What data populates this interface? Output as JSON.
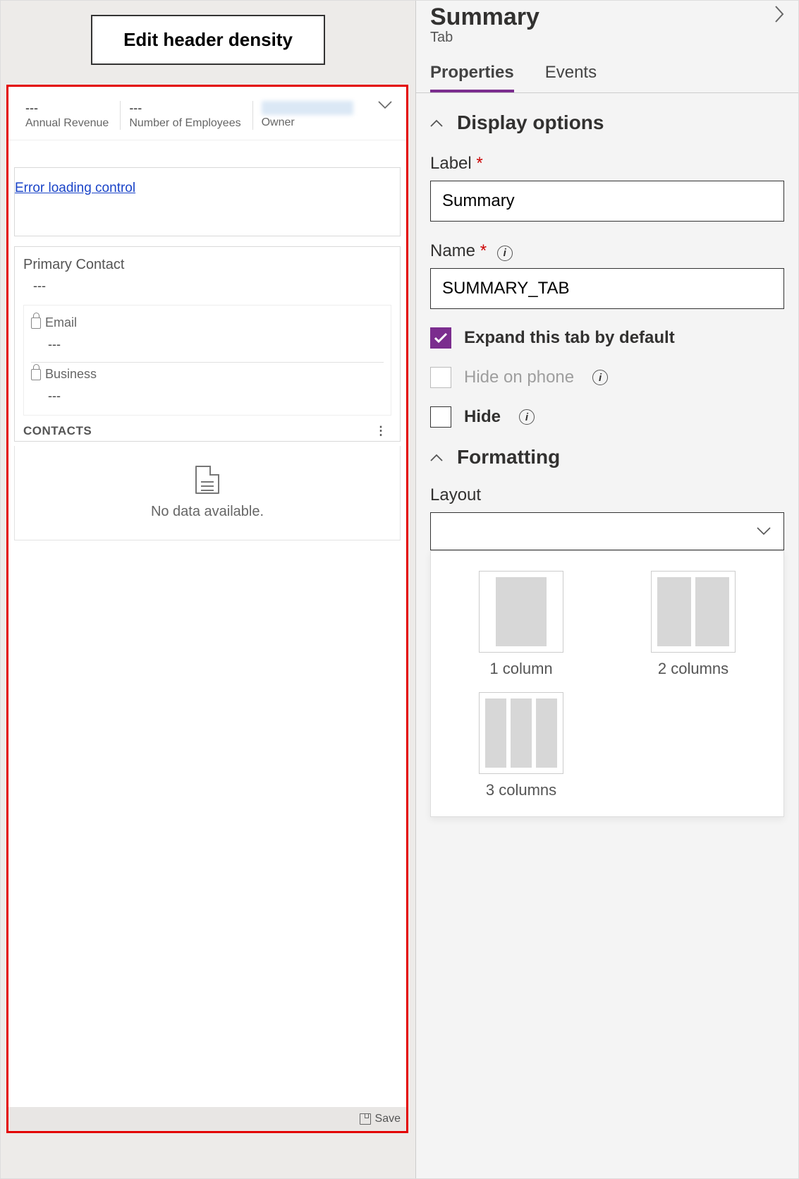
{
  "left": {
    "edit_header_btn": "Edit header density",
    "header_fields": {
      "annual_revenue": {
        "value": "---",
        "label": "Annual Revenue"
      },
      "employees": {
        "value": "---",
        "label": "Number of Employees"
      },
      "owner": {
        "label": "Owner"
      }
    },
    "error_link": "Error loading control",
    "primary_contact": {
      "label": "Primary Contact",
      "value": "---"
    },
    "email": {
      "label": "Email",
      "value": "---"
    },
    "business": {
      "label": "Business",
      "value": "---"
    },
    "contacts_hdr": "CONTACTS",
    "no_data": "No data available.",
    "save": "Save"
  },
  "right": {
    "title": "Summary",
    "subtitle": "Tab",
    "tabs": {
      "properties": "Properties",
      "events": "Events"
    },
    "display_options": "Display options",
    "label_field": {
      "label": "Label",
      "value": "Summary"
    },
    "name_field": {
      "label": "Name",
      "value": "SUMMARY_TAB"
    },
    "expand_default": "Expand this tab by default",
    "hide_phone": "Hide on phone",
    "hide": "Hide",
    "formatting": "Formatting",
    "layout_label": "Layout",
    "layout_options": {
      "one": "1 column",
      "two": "2 columns",
      "three": "3 columns"
    }
  }
}
